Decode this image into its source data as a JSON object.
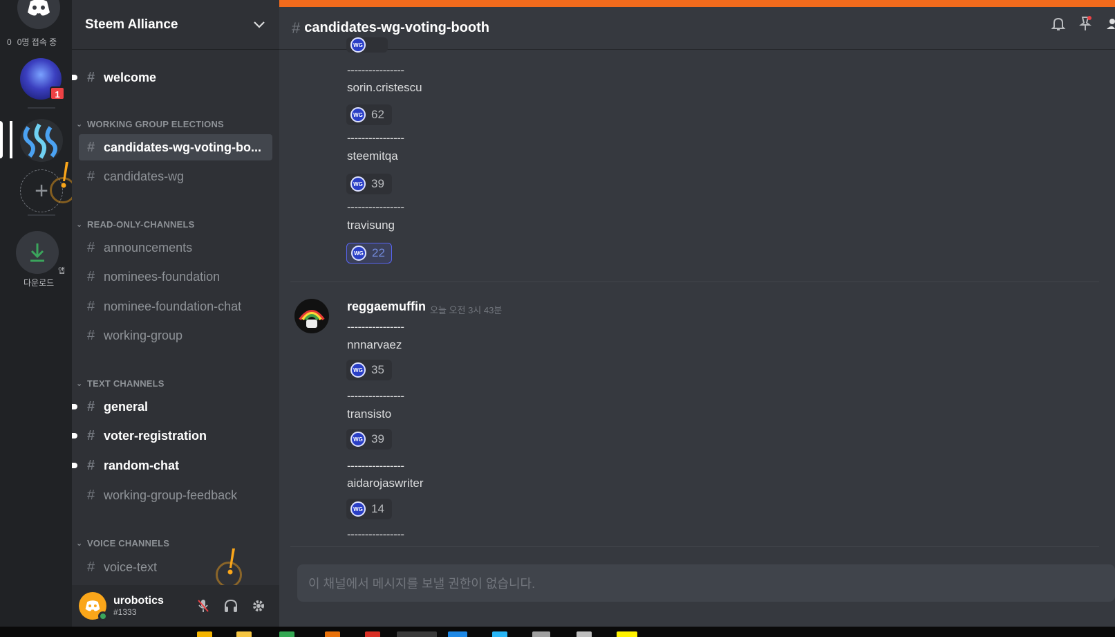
{
  "server_rail": {
    "online_zero": "0",
    "online_text": "0명 접속 중",
    "mention_badge": "1",
    "download_small": "앱",
    "download_label": "다운로드"
  },
  "guild": {
    "name": "Steem Alliance"
  },
  "channels": {
    "welcome": "welcome",
    "cat_working_group_elections": "WORKING GROUP ELECTIONS",
    "candidates_wg_voting_booth": "candidates-wg-voting-bo...",
    "candidates_wg": "candidates-wg",
    "cat_read_only": "READ-ONLY-CHANNELS",
    "announcements": "announcements",
    "nominees_foundation": "nominees-foundation",
    "nominee_foundation_chat": "nominee-foundation-chat",
    "working_group": "working-group",
    "cat_text": "TEXT CHANNELS",
    "general": "general",
    "voter_registration": "voter-registration",
    "random_chat": "random-chat",
    "working_group_feedback": "working-group-feedback",
    "cat_voice": "VOICE CHANNELS",
    "voice_text": "voice-text"
  },
  "user": {
    "name": "urobotics",
    "tag": "#1333"
  },
  "header": {
    "channel_title": "candidates-wg-voting-booth"
  },
  "messages": {
    "separator": "----------------",
    "block1": [
      {
        "name": "sorin.cristescu",
        "count": "62"
      },
      {
        "name": "steemitqa",
        "count": "39"
      },
      {
        "name": "travisung",
        "count": "22"
      }
    ],
    "author": "reggaemuffin",
    "timestamp": "오늘 오전 3시 43분",
    "block2": [
      {
        "name": "nnnarvaez",
        "count": "35"
      },
      {
        "name": "transisto",
        "count": "39"
      },
      {
        "name": "aidarojaswriter",
        "count": "14"
      }
    ],
    "reaction_emoji_text": "WG"
  },
  "composer": {
    "placeholder": "이 채널에서 메시지를 보낼 권한이 없습니다."
  },
  "colors": {
    "accent_orange": "#f26b1d",
    "blurple": "#5865f2",
    "warning": "#faa61a"
  }
}
